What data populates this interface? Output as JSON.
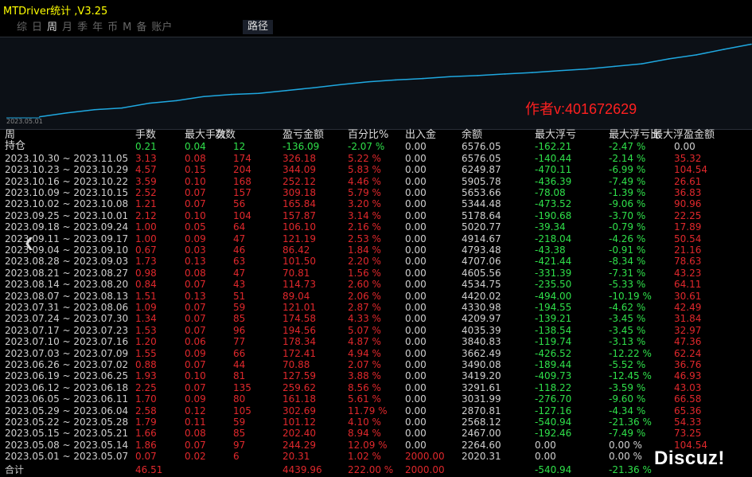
{
  "app": {
    "title": "MTDriver统计 ,V3.25"
  },
  "tabs": [
    {
      "label": "综",
      "active": false
    },
    {
      "label": "日",
      "active": false
    },
    {
      "label": "周",
      "active": true
    },
    {
      "label": "月",
      "active": false
    },
    {
      "label": "季",
      "active": false
    },
    {
      "label": "年",
      "active": false
    },
    {
      "label": "币",
      "active": false
    },
    {
      "label": "M",
      "active": false
    },
    {
      "label": "备",
      "active": false
    },
    {
      "label": "账户",
      "active": false
    }
  ],
  "path_button": "路径",
  "chart": {
    "start_date_label": "2023.05.01",
    "line_color": "#1fa8e0"
  },
  "chart_data": {
    "type": "line",
    "x": [
      "2023.05.01",
      "2023.05.08",
      "2023.05.15",
      "2023.05.22",
      "2023.05.29",
      "2023.06.05",
      "2023.06.12",
      "2023.06.19",
      "2023.06.26",
      "2023.07.03",
      "2023.07.10",
      "2023.07.17",
      "2023.07.24",
      "2023.07.31",
      "2023.08.07",
      "2023.08.14",
      "2023.08.21",
      "2023.08.28",
      "2023.09.04",
      "2023.09.11",
      "2023.09.18",
      "2023.09.25",
      "2023.10.02",
      "2023.10.09",
      "2023.10.16",
      "2023.10.23",
      "2023.10.30"
    ],
    "values": [
      2020.31,
      2264.6,
      2467.0,
      2568.12,
      2870.81,
      3031.99,
      3291.61,
      3419.2,
      3490.08,
      3662.49,
      3840.83,
      4035.39,
      4209.97,
      4330.98,
      4420.02,
      4534.75,
      4605.56,
      4707.06,
      4793.48,
      4914.67,
      5020.77,
      5178.64,
      5344.48,
      5653.66,
      5905.78,
      6249.87,
      6576.05
    ]
  },
  "author_text": "作者v:401672629",
  "watermark": "Discuz!",
  "headers": [
    "周",
    "手数",
    "最大手数",
    "次数",
    "盈亏金额",
    "百分比%",
    "出入金",
    "余额",
    "最大浮亏",
    "最大浮亏比",
    "最大浮盈金额"
  ],
  "holding": {
    "label": "持仓",
    "lots": "0.21",
    "max_lots": "0.04",
    "count": "12",
    "pnl": "-136.09",
    "pct": "-2.07 %",
    "flow": "0.00",
    "balance": "6576.05",
    "max_dd": "-162.21",
    "max_dd_pct": "-2.47 %",
    "max_fp": "0.00"
  },
  "rows": [
    {
      "period": "2023.10.30 ~ 2023.11.05",
      "lots": "3.13",
      "max_lots": "0.08",
      "count": "174",
      "pnl": "326.18",
      "pct": "5.22 %",
      "flow": "0.00",
      "balance": "6576.05",
      "max_dd": "-140.44",
      "max_dd_pct": "-2.14 %",
      "max_fp": "35.32"
    },
    {
      "period": "2023.10.23 ~ 2023.10.29",
      "lots": "4.57",
      "max_lots": "0.15",
      "count": "204",
      "pnl": "344.09",
      "pct": "5.83 %",
      "flow": "0.00",
      "balance": "6249.87",
      "max_dd": "-470.11",
      "max_dd_pct": "-6.99 %",
      "max_fp": "104.54"
    },
    {
      "period": "2023.10.16 ~ 2023.10.22",
      "lots": "3.59",
      "max_lots": "0.10",
      "count": "168",
      "pnl": "252.12",
      "pct": "4.46 %",
      "flow": "0.00",
      "balance": "5905.78",
      "max_dd": "-436.39",
      "max_dd_pct": "-7.49 %",
      "max_fp": "26.61"
    },
    {
      "period": "2023.10.09 ~ 2023.10.15",
      "lots": "2.52",
      "max_lots": "0.07",
      "count": "157",
      "pnl": "309.18",
      "pct": "5.79 %",
      "flow": "0.00",
      "balance": "5653.66",
      "max_dd": "-78.08",
      "max_dd_pct": "-1.39 %",
      "max_fp": "36.83"
    },
    {
      "period": "2023.10.02 ~ 2023.10.08",
      "lots": "1.21",
      "max_lots": "0.07",
      "count": "56",
      "pnl": "165.84",
      "pct": "3.20 %",
      "flow": "0.00",
      "balance": "5344.48",
      "max_dd": "-473.52",
      "max_dd_pct": "-9.06 %",
      "max_fp": "90.96"
    },
    {
      "period": "2023.09.25 ~ 2023.10.01",
      "lots": "2.12",
      "max_lots": "0.10",
      "count": "104",
      "pnl": "157.87",
      "pct": "3.14 %",
      "flow": "0.00",
      "balance": "5178.64",
      "max_dd": "-190.68",
      "max_dd_pct": "-3.70 %",
      "max_fp": "22.25"
    },
    {
      "period": "2023.09.18 ~ 2023.09.24",
      "lots": "1.00",
      "max_lots": "0.05",
      "count": "64",
      "pnl": "106.10",
      "pct": "2.16 %",
      "flow": "0.00",
      "balance": "5020.77",
      "max_dd": "-39.34",
      "max_dd_pct": "-0.79 %",
      "max_fp": "17.89"
    },
    {
      "period": "2023.09.11 ~ 2023.09.17",
      "lots": "1.00",
      "max_lots": "0.09",
      "count": "47",
      "pnl": "121.19",
      "pct": "2.53 %",
      "flow": "0.00",
      "balance": "4914.67",
      "max_dd": "-218.04",
      "max_dd_pct": "-4.26 %",
      "max_fp": "50.54"
    },
    {
      "period": "2023.09.04 ~ 2023.09.10",
      "lots": "0.67",
      "max_lots": "0.03",
      "count": "46",
      "pnl": "86.42",
      "pct": "1.84 %",
      "flow": "0.00",
      "balance": "4793.48",
      "max_dd": "-43.38",
      "max_dd_pct": "-0.91 %",
      "max_fp": "21.16"
    },
    {
      "period": "2023.08.28 ~ 2023.09.03",
      "lots": "1.73",
      "max_lots": "0.13",
      "count": "63",
      "pnl": "101.50",
      "pct": "2.20 %",
      "flow": "0.00",
      "balance": "4707.06",
      "max_dd": "-421.44",
      "max_dd_pct": "-8.34 %",
      "max_fp": "78.63"
    },
    {
      "period": "2023.08.21 ~ 2023.08.27",
      "lots": "0.98",
      "max_lots": "0.08",
      "count": "47",
      "pnl": "70.81",
      "pct": "1.56 %",
      "flow": "0.00",
      "balance": "4605.56",
      "max_dd": "-331.39",
      "max_dd_pct": "-7.31 %",
      "max_fp": "43.23"
    },
    {
      "period": "2023.08.14 ~ 2023.08.20",
      "lots": "0.84",
      "max_lots": "0.07",
      "count": "43",
      "pnl": "114.73",
      "pct": "2.60 %",
      "flow": "0.00",
      "balance": "4534.75",
      "max_dd": "-235.50",
      "max_dd_pct": "-5.33 %",
      "max_fp": "64.11"
    },
    {
      "period": "2023.08.07 ~ 2023.08.13",
      "lots": "1.51",
      "max_lots": "0.13",
      "count": "51",
      "pnl": "89.04",
      "pct": "2.06 %",
      "flow": "0.00",
      "balance": "4420.02",
      "max_dd": "-494.00",
      "max_dd_pct": "-10.19 %",
      "max_fp": "30.61"
    },
    {
      "period": "2023.07.31 ~ 2023.08.06",
      "lots": "1.09",
      "max_lots": "0.07",
      "count": "59",
      "pnl": "121.01",
      "pct": "2.87 %",
      "flow": "0.00",
      "balance": "4330.98",
      "max_dd": "-194.55",
      "max_dd_pct": "-4.62 %",
      "max_fp": "42.49"
    },
    {
      "period": "2023.07.24 ~ 2023.07.30",
      "lots": "1.34",
      "max_lots": "0.07",
      "count": "85",
      "pnl": "174.58",
      "pct": "4.33 %",
      "flow": "0.00",
      "balance": "4209.97",
      "max_dd": "-139.21",
      "max_dd_pct": "-3.45 %",
      "max_fp": "31.84"
    },
    {
      "period": "2023.07.17 ~ 2023.07.23",
      "lots": "1.53",
      "max_lots": "0.07",
      "count": "96",
      "pnl": "194.56",
      "pct": "5.07 %",
      "flow": "0.00",
      "balance": "4035.39",
      "max_dd": "-138.54",
      "max_dd_pct": "-3.45 %",
      "max_fp": "32.97"
    },
    {
      "period": "2023.07.10 ~ 2023.07.16",
      "lots": "1.20",
      "max_lots": "0.06",
      "count": "77",
      "pnl": "178.34",
      "pct": "4.87 %",
      "flow": "0.00",
      "balance": "3840.83",
      "max_dd": "-119.74",
      "max_dd_pct": "-3.13 %",
      "max_fp": "47.36"
    },
    {
      "period": "2023.07.03 ~ 2023.07.09",
      "lots": "1.55",
      "max_lots": "0.09",
      "count": "66",
      "pnl": "172.41",
      "pct": "4.94 %",
      "flow": "0.00",
      "balance": "3662.49",
      "max_dd": "-426.52",
      "max_dd_pct": "-12.22 %",
      "max_fp": "62.24"
    },
    {
      "period": "2023.06.26 ~ 2023.07.02",
      "lots": "0.88",
      "max_lots": "0.07",
      "count": "44",
      "pnl": "70.88",
      "pct": "2.07 %",
      "flow": "0.00",
      "balance": "3490.08",
      "max_dd": "-189.44",
      "max_dd_pct": "-5.52 %",
      "max_fp": "36.76"
    },
    {
      "period": "2023.06.19 ~ 2023.06.25",
      "lots": "1.93",
      "max_lots": "0.10",
      "count": "81",
      "pnl": "127.59",
      "pct": "3.88 %",
      "flow": "0.00",
      "balance": "3419.20",
      "max_dd": "-409.73",
      "max_dd_pct": "-12.45 %",
      "max_fp": "46.93"
    },
    {
      "period": "2023.06.12 ~ 2023.06.18",
      "lots": "2.25",
      "max_lots": "0.07",
      "count": "135",
      "pnl": "259.62",
      "pct": "8.56 %",
      "flow": "0.00",
      "balance": "3291.61",
      "max_dd": "-118.22",
      "max_dd_pct": "-3.59 %",
      "max_fp": "43.03"
    },
    {
      "period": "2023.06.05 ~ 2023.06.11",
      "lots": "1.70",
      "max_lots": "0.09",
      "count": "80",
      "pnl": "161.18",
      "pct": "5.61 %",
      "flow": "0.00",
      "balance": "3031.99",
      "max_dd": "-276.70",
      "max_dd_pct": "-9.60 %",
      "max_fp": "66.58"
    },
    {
      "period": "2023.05.29 ~ 2023.06.04",
      "lots": "2.58",
      "max_lots": "0.12",
      "count": "105",
      "pnl": "302.69",
      "pct": "11.79 %",
      "flow": "0.00",
      "balance": "2870.81",
      "max_dd": "-127.16",
      "max_dd_pct": "-4.34 %",
      "max_fp": "65.36"
    },
    {
      "period": "2023.05.22 ~ 2023.05.28",
      "lots": "1.79",
      "max_lots": "0.11",
      "count": "59",
      "pnl": "101.12",
      "pct": "4.10 %",
      "flow": "0.00",
      "balance": "2568.12",
      "max_dd": "-540.94",
      "max_dd_pct": "-21.36 %",
      "max_fp": "54.33"
    },
    {
      "period": "2023.05.15 ~ 2023.05.21",
      "lots": "1.66",
      "max_lots": "0.08",
      "count": "85",
      "pnl": "202.40",
      "pct": "8.94 %",
      "flow": "0.00",
      "balance": "2467.00",
      "max_dd": "-192.46",
      "max_dd_pct": "-7.49 %",
      "max_fp": "73.25"
    },
    {
      "period": "2023.05.08 ~ 2023.05.14",
      "lots": "1.86",
      "max_lots": "0.07",
      "count": "97",
      "pnl": "244.29",
      "pct": "12.09 %",
      "flow": "0.00",
      "balance": "2264.60",
      "max_dd": "0.00",
      "max_dd_pct": "0.00 %",
      "max_fp": "104.54"
    },
    {
      "period": "2023.05.01 ~ 2023.05.07",
      "lots": "0.07",
      "max_lots": "0.02",
      "count": "6",
      "pnl": "20.31",
      "pct": "1.02 %",
      "flow": "2000.00",
      "balance": "2020.31",
      "max_dd": "0.00",
      "max_dd_pct": "0.00 %",
      "max_fp": ""
    }
  ],
  "totals": {
    "label": "合计",
    "lots": "46.51",
    "pnl": "4439.96",
    "pct": "222.00 %",
    "flow": "2000.00",
    "max_dd": "-540.94",
    "max_dd_pct": "-21.36 %"
  },
  "colors": {
    "positive": "#e0282c",
    "negative": "#2fe04a",
    "title": "#ffff00",
    "author": "#ff2020"
  }
}
